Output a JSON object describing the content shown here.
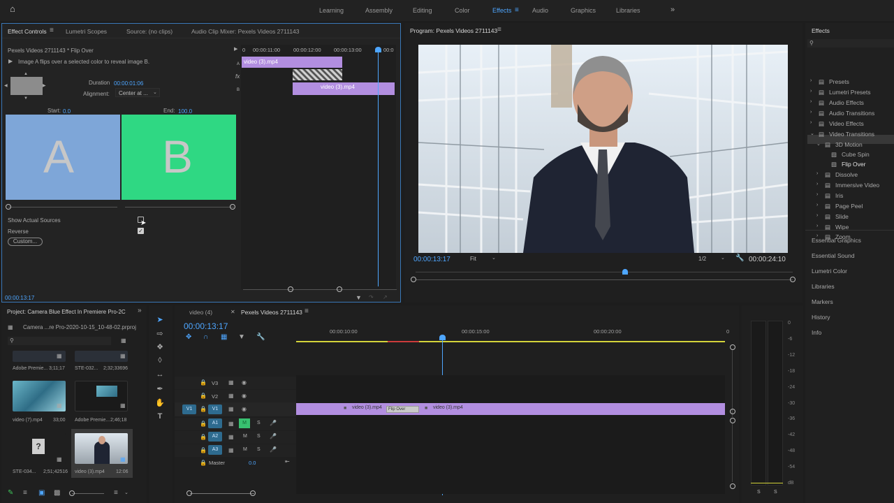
{
  "workspaces": [
    {
      "label": "Learning",
      "active": false
    },
    {
      "label": "Assembly",
      "active": false
    },
    {
      "label": "Editing",
      "active": false
    },
    {
      "label": "Color",
      "active": false
    },
    {
      "label": "Effects",
      "active": true
    },
    {
      "label": "Audio",
      "active": false
    },
    {
      "label": "Graphics",
      "active": false
    },
    {
      "label": "Libraries",
      "active": false
    }
  ],
  "effect_controls": {
    "tabs": [
      "Effect Controls",
      "Lumetri Scopes",
      "Source: (no clips)",
      "Audio Clip Mixer: Pexels Videos 2711143"
    ],
    "clip_title": "Pexels Videos 2711143 * Flip Over",
    "description": "Image A flips over a selected color to reveal image B.",
    "duration_label": "Duration",
    "duration_value": "00:00:01:06",
    "alignment_label": "Alignment:",
    "alignment_value": "Center at ...",
    "start_label": "Start:",
    "start_value": "0.0",
    "end_label": "End:",
    "end_value": "100.0",
    "a_label": "A",
    "b_label": "B",
    "show_actual_sources": "Show Actual Sources",
    "reverse": "Reverse",
    "custom_button": "Custom...",
    "timecode": "00:00:13:17",
    "ruler": [
      "0",
      "00:00:11:00",
      "00:00:12:00",
      "00:00:13:00",
      "00:0"
    ],
    "clip_a": "video (3).mp4",
    "clip_b": "video (3).mp4",
    "track_a": "A",
    "track_b": "B",
    "fx": "fx"
  },
  "program": {
    "title": "Program: Pexels Videos 2711143",
    "timecode": "00:00:13:17",
    "fit": "Fit",
    "resolution": "1/2",
    "duration": "00:00:24:10"
  },
  "effects_panel": {
    "title": "Effects",
    "items": [
      {
        "label": "Presets",
        "level": 0,
        "kind": "folder"
      },
      {
        "label": "Lumetri Presets",
        "level": 0,
        "kind": "folder"
      },
      {
        "label": "Audio Effects",
        "level": 0,
        "kind": "folder"
      },
      {
        "label": "Audio Transitions",
        "level": 0,
        "kind": "folder"
      },
      {
        "label": "Video Effects",
        "level": 0,
        "kind": "folder"
      },
      {
        "label": "Video Transitions",
        "level": 0,
        "kind": "folder",
        "open": true
      },
      {
        "label": "3D Motion",
        "level": 1,
        "kind": "folder",
        "open": true
      },
      {
        "label": "Cube Spin",
        "level": 2,
        "kind": "effect"
      },
      {
        "label": "Flip Over",
        "level": 2,
        "kind": "effect",
        "selected": true
      },
      {
        "label": "Dissolve",
        "level": 1,
        "kind": "folder"
      },
      {
        "label": "Immersive Video",
        "level": 1,
        "kind": "folder"
      },
      {
        "label": "Iris",
        "level": 1,
        "kind": "folder"
      },
      {
        "label": "Page Peel",
        "level": 1,
        "kind": "folder"
      },
      {
        "label": "Slide",
        "level": 1,
        "kind": "folder"
      },
      {
        "label": "Wipe",
        "level": 1,
        "kind": "folder"
      },
      {
        "label": "Zoom",
        "level": 1,
        "kind": "folder"
      }
    ],
    "nav": [
      "Essential Graphics",
      "Essential Sound",
      "Lumetri Color",
      "Libraries",
      "Markers",
      "History",
      "Info"
    ]
  },
  "project": {
    "title": "Project: Camera Blue Effect In Premiere Pro-2C",
    "path": "Camera ...re Pro-2020-10-15_10-48-02.prproj",
    "items": [
      {
        "name": "Adobe Premie...",
        "duration": "3;11;17"
      },
      {
        "name": "STE-032...",
        "duration": "2;32;33696"
      },
      {
        "name": "video (7).mp4",
        "duration": "33;00"
      },
      {
        "name": "Adobe Premie...",
        "duration": "2;46;18"
      },
      {
        "name": "STE-034...",
        "duration": "2;51;42516"
      },
      {
        "name": "video (3).mp4",
        "duration": "12:06"
      }
    ]
  },
  "timeline": {
    "tabs": [
      "video (4)",
      "Pexels Videos 2711143"
    ],
    "timecode": "00:00:13:17",
    "ruler": [
      "00:00:10:00",
      "00:00:15:00",
      "00:00:20:00",
      "0"
    ],
    "video_tracks": [
      "V3",
      "V2",
      "V1"
    ],
    "source_patch": "V1",
    "audio_tracks": [
      "A1",
      "A2",
      "A3"
    ],
    "mute": "M",
    "solo": "S",
    "master_label": "Master",
    "master_value": "0.0",
    "clip1": "video (3).mp4",
    "transition": "Flip Over",
    "clip2": "video (3).mp4"
  },
  "meter": {
    "labels": [
      "0",
      "-6",
      "-12",
      "-18",
      "-24",
      "-30",
      "-36",
      "-42",
      "-48",
      "-54",
      "dB"
    ],
    "solo_left": "S",
    "solo_right": "S"
  },
  "colors": {
    "accent": "#4ea6ff",
    "clip": "#b28ee0",
    "a_panel": "#7ea6d8",
    "b_panel": "#2fd883"
  }
}
